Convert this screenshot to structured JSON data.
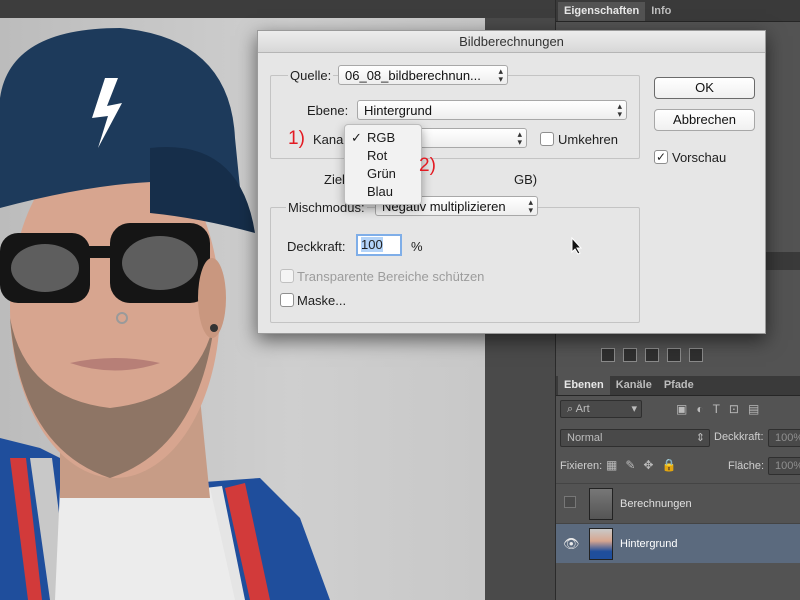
{
  "panel": {
    "tabs": [
      "Eigenschaften",
      "Info"
    ]
  },
  "dialog": {
    "title": "Bildberechnungen",
    "quelle_label": "Quelle:",
    "quelle_value": "06_08_bildberechnun...",
    "ebene_label": "Ebene:",
    "ebene_value": "Hintergrund",
    "kanal_label": "Kanal",
    "umkehren_label": "Umkehren",
    "ziel_label": "Ziel",
    "ziel_suffix": "GB)",
    "mischmodus_label": "Mischmodus:",
    "mischmodus_value": "Negativ multiplizieren",
    "deckkraft_label": "Deckkraft:",
    "deckkraft_value": "100",
    "deckkraft_unit": "%",
    "transparente_label": "Transparente Bereiche schützen",
    "maske_label": "Maske...",
    "ok_label": "OK",
    "abbrechen_label": "Abbrechen",
    "vorschau_label": "Vorschau",
    "vorschau_checked": true
  },
  "kanal_menu": {
    "items": [
      "RGB",
      "Rot",
      "Grün",
      "Blau"
    ],
    "selected": "RGB"
  },
  "annotations": {
    "one": "1)",
    "two": "2)"
  },
  "layers_panel": {
    "tabs": [
      "Ebenen",
      "Kanäle",
      "Pfade"
    ],
    "filter_label": "Art",
    "blend_mode": "Normal",
    "opacity_label": "Deckkraft:",
    "opacity_value": "100%",
    "lock_label": "Fixieren:",
    "fill_label": "Fläche:",
    "fill_value": "100%",
    "layers": [
      {
        "name": "Berechnungen",
        "visible": false,
        "selected": false
      },
      {
        "name": "Hintergrund",
        "visible": true,
        "selected": true
      }
    ]
  },
  "colors": {
    "accent_blue": "#7faee8",
    "annotation_red": "#e31b23",
    "selected_layer": "#5b6a7e"
  }
}
